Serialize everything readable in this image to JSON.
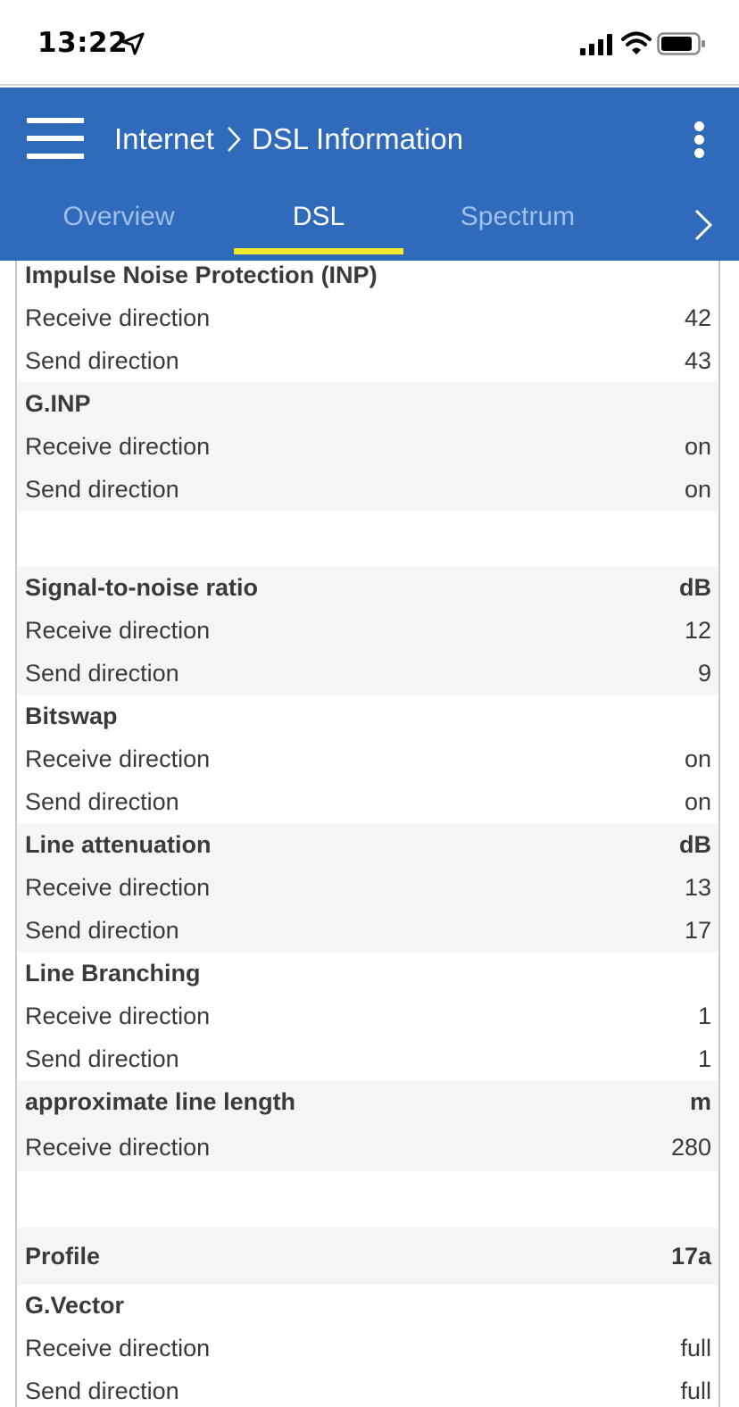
{
  "status_bar": {
    "time": "13:22",
    "icons": [
      "location-arrow-icon",
      "cellular-signal-icon",
      "wifi-icon",
      "battery-icon"
    ]
  },
  "header": {
    "breadcrumb": [
      "Internet",
      "DSL Information"
    ],
    "menu_icon": "hamburger-menu-icon",
    "more_icon": "more-vertical-icon",
    "accent_color": "#2f6bba"
  },
  "tabs": {
    "items": [
      {
        "label": "Overview",
        "active": false
      },
      {
        "label": "DSL",
        "active": true
      },
      {
        "label": "Spectrum",
        "active": false
      }
    ],
    "indicator_color": "#f3ea2e",
    "next_icon": "chevron-right-icon"
  },
  "table": [
    {
      "label": "Impulse Noise Protection (INP)",
      "value": "",
      "type": "header"
    },
    {
      "label": "Receive direction",
      "value": "42",
      "type": "row"
    },
    {
      "label": "Send direction",
      "value": "43",
      "type": "row"
    },
    {
      "label": "G.INP",
      "value": "",
      "type": "header"
    },
    {
      "label": "Receive direction",
      "value": "on",
      "type": "row"
    },
    {
      "label": "Send direction",
      "value": "on",
      "type": "row"
    },
    {
      "label": "Signal-to-noise ratio",
      "value": "dB",
      "type": "header"
    },
    {
      "label": "Receive direction",
      "value": "12",
      "type": "row"
    },
    {
      "label": "Send direction",
      "value": "9",
      "type": "row"
    },
    {
      "label": "Bitswap",
      "value": "",
      "type": "header"
    },
    {
      "label": "Receive direction",
      "value": "on",
      "type": "row"
    },
    {
      "label": "Send direction",
      "value": "on",
      "type": "row"
    },
    {
      "label": "Line attenuation",
      "value": "dB",
      "type": "header"
    },
    {
      "label": "Receive direction",
      "value": "13",
      "type": "row"
    },
    {
      "label": "Send direction",
      "value": "17",
      "type": "row"
    },
    {
      "label": "Line Branching",
      "value": "",
      "type": "header"
    },
    {
      "label": "Receive direction",
      "value": "1",
      "type": "row"
    },
    {
      "label": "Send direction",
      "value": "1",
      "type": "row"
    },
    {
      "label": "approximate line length",
      "value": "m",
      "type": "header"
    },
    {
      "label": "Receive direction",
      "value": "280",
      "type": "row"
    },
    {
      "label": "Profile",
      "value": "17a",
      "type": "header"
    },
    {
      "label": "G.Vector",
      "value": "",
      "type": "header"
    },
    {
      "label": "Receive direction",
      "value": "full",
      "type": "row"
    },
    {
      "label": "Send direction",
      "value": "full",
      "type": "row"
    }
  ]
}
